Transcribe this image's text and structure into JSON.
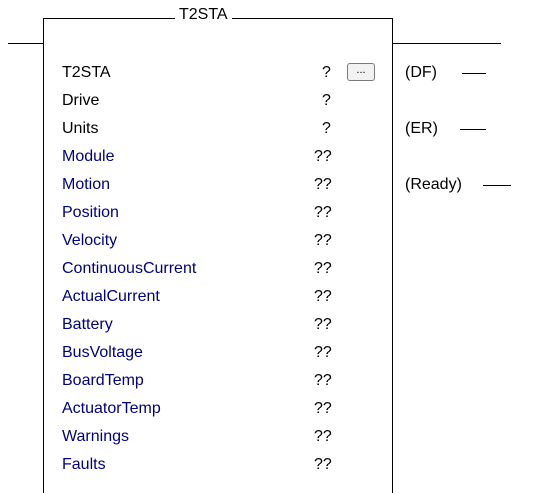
{
  "block": {
    "title": "T2STA",
    "browse_label": "..."
  },
  "params": [
    {
      "label": "T2STA",
      "value": "?",
      "color": "black"
    },
    {
      "label": "Drive",
      "value": "?",
      "color": "black"
    },
    {
      "label": "Units",
      "value": "?",
      "color": "black"
    },
    {
      "label": "Module",
      "value": "??",
      "color": "blue"
    },
    {
      "label": "Motion",
      "value": "??",
      "color": "blue"
    },
    {
      "label": "Position",
      "value": "??",
      "color": "blue"
    },
    {
      "label": "Velocity",
      "value": "??",
      "color": "blue"
    },
    {
      "label": "ContinuousCurrent",
      "value": "??",
      "color": "blue"
    },
    {
      "label": "ActualCurrent",
      "value": "??",
      "color": "blue"
    },
    {
      "label": "Battery",
      "value": "??",
      "color": "blue"
    },
    {
      "label": "BusVoltage",
      "value": "??",
      "color": "blue"
    },
    {
      "label": "BoardTemp",
      "value": "??",
      "color": "blue"
    },
    {
      "label": "ActuatorTemp",
      "value": "??",
      "color": "blue"
    },
    {
      "label": "Warnings",
      "value": "??",
      "color": "blue"
    },
    {
      "label": "Faults",
      "value": "??",
      "color": "blue"
    }
  ],
  "coils": [
    {
      "label": "DF"
    },
    {
      "label": "ER"
    },
    {
      "label": "Ready"
    }
  ]
}
